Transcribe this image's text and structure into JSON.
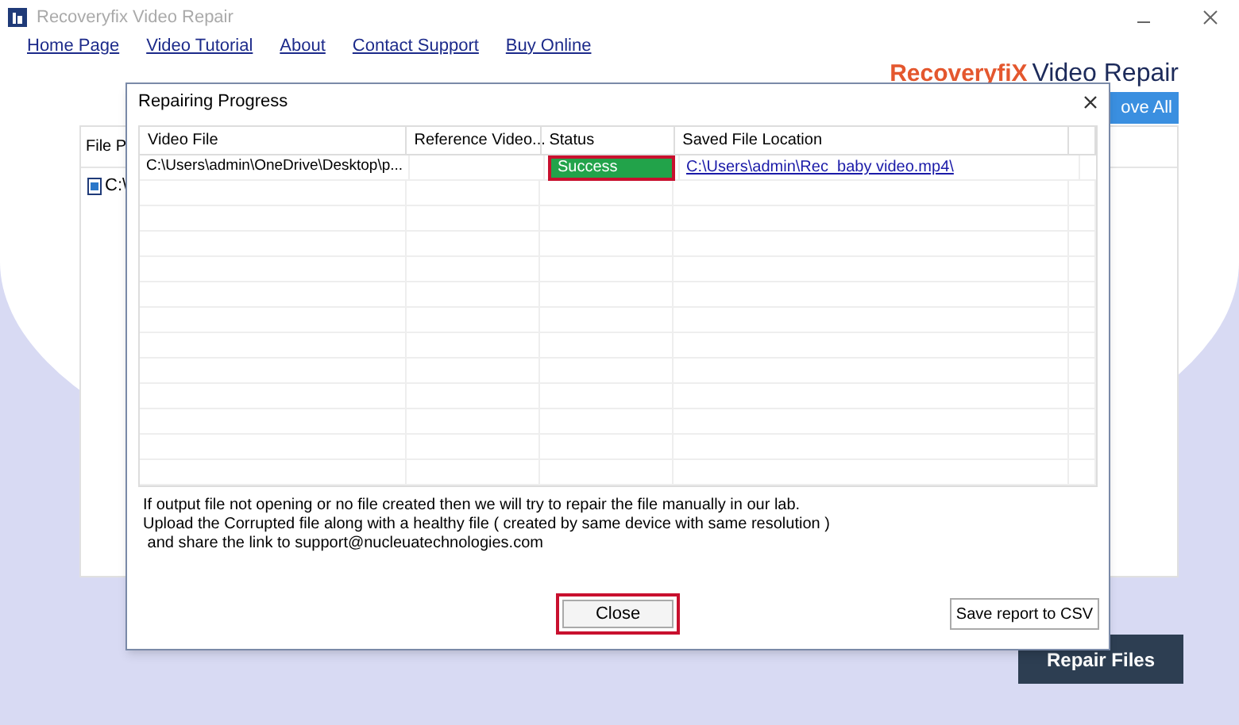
{
  "window": {
    "title": "Recoveryfix Video Repair"
  },
  "nav": [
    "Home Page",
    "Video Tutorial",
    "About",
    "Contact Support",
    "Buy Online"
  ],
  "logo": {
    "brand": "RecoveryfiX",
    "product": "Video Repair"
  },
  "main": {
    "remove_all_button": "ove All",
    "column_1": "File P",
    "rows": [
      "C:\\"
    ],
    "repair_button": "Repair Files"
  },
  "dialog": {
    "title": "Repairing Progress",
    "columns": [
      "Video File",
      "Reference Video...",
      "Status",
      "Saved File Location"
    ],
    "rows": [
      {
        "video_file": "C:\\Users\\admin\\OneDrive\\Desktop\\p...",
        "reference": "",
        "status": "Success",
        "status_highlighted": true,
        "saved_location": "C:\\Users\\admin\\Rec_baby video.mp4\\"
      }
    ],
    "note": [
      "If output file not opening or no file created then we will try to repair the file manually in our lab.",
      "Upload the Corrupted file along with a healthy file ( created by same device with same resolution )",
      " and share the link to support@nucleuatechnologies.com"
    ],
    "close_button": {
      "label": "Close",
      "highlighted": true
    },
    "csv_button": "Save report to CSV"
  }
}
